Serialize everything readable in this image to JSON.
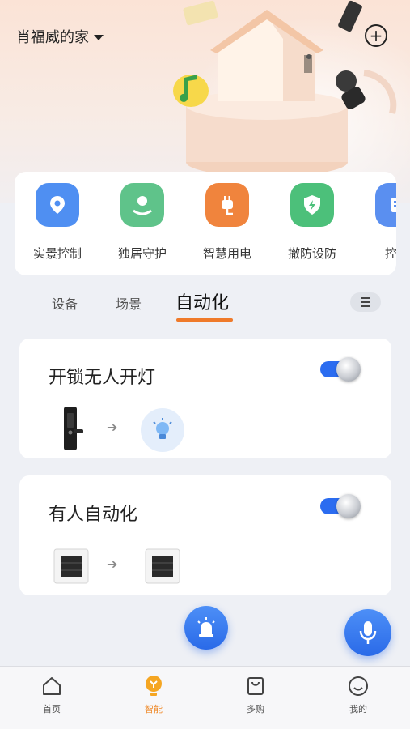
{
  "header": {
    "home_name": "肖福威的家"
  },
  "quick_actions": [
    {
      "label": "实景控制",
      "icon": "location-pin-icon",
      "color": "#4f8ff2"
    },
    {
      "label": "独居守护",
      "icon": "person-guard-icon",
      "color": "#5fc38a"
    },
    {
      "label": "智慧用电",
      "icon": "power-plug-icon",
      "color": "#f0843d"
    },
    {
      "label": "撤防设防",
      "icon": "shield-bolt-icon",
      "color": "#4cc07a"
    },
    {
      "label": "控制",
      "icon": "control-panel-icon",
      "color": "#5a8ff0"
    }
  ],
  "tabs": [
    {
      "label": "设备",
      "active": false
    },
    {
      "label": "场景",
      "active": false
    },
    {
      "label": "自动化",
      "active": true
    }
  ],
  "automations": [
    {
      "title": "开锁无人开灯",
      "enabled": true,
      "trigger": "door-lock-icon",
      "action": "light-bulb-icon"
    },
    {
      "title": "有人自动化",
      "enabled": true,
      "trigger": "switch-panel-icon",
      "action": "switch-panel-icon"
    }
  ],
  "bottom_nav": [
    {
      "label": "首页",
      "icon": "home-icon",
      "active": false
    },
    {
      "label": "智能",
      "icon": "smart-bulb-icon",
      "active": true
    },
    {
      "label": "多购",
      "icon": "shopping-bag-icon",
      "active": false
    },
    {
      "label": "我的",
      "icon": "smiley-icon",
      "active": false
    }
  ],
  "colors": {
    "accent": "#ef7a2a",
    "primary": "#2b6cf0"
  }
}
